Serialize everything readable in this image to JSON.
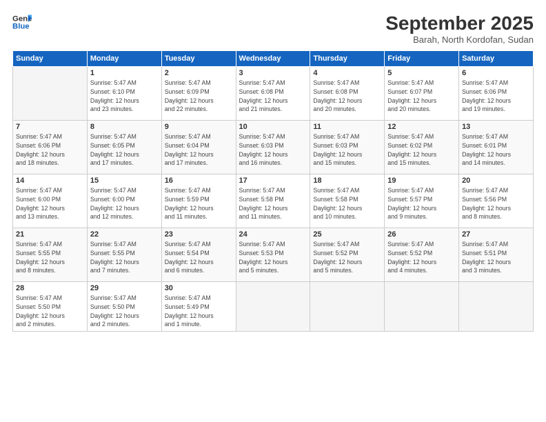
{
  "header": {
    "logo_line1": "General",
    "logo_line2": "Blue",
    "month_title": "September 2025",
    "subtitle": "Barah, North Kordofan, Sudan"
  },
  "days_of_week": [
    "Sunday",
    "Monday",
    "Tuesday",
    "Wednesday",
    "Thursday",
    "Friday",
    "Saturday"
  ],
  "weeks": [
    [
      {
        "day": "",
        "info": ""
      },
      {
        "day": "1",
        "info": "Sunrise: 5:47 AM\nSunset: 6:10 PM\nDaylight: 12 hours\nand 23 minutes."
      },
      {
        "day": "2",
        "info": "Sunrise: 5:47 AM\nSunset: 6:09 PM\nDaylight: 12 hours\nand 22 minutes."
      },
      {
        "day": "3",
        "info": "Sunrise: 5:47 AM\nSunset: 6:08 PM\nDaylight: 12 hours\nand 21 minutes."
      },
      {
        "day": "4",
        "info": "Sunrise: 5:47 AM\nSunset: 6:08 PM\nDaylight: 12 hours\nand 20 minutes."
      },
      {
        "day": "5",
        "info": "Sunrise: 5:47 AM\nSunset: 6:07 PM\nDaylight: 12 hours\nand 20 minutes."
      },
      {
        "day": "6",
        "info": "Sunrise: 5:47 AM\nSunset: 6:06 PM\nDaylight: 12 hours\nand 19 minutes."
      }
    ],
    [
      {
        "day": "7",
        "info": "Sunrise: 5:47 AM\nSunset: 6:06 PM\nDaylight: 12 hours\nand 18 minutes."
      },
      {
        "day": "8",
        "info": "Sunrise: 5:47 AM\nSunset: 6:05 PM\nDaylight: 12 hours\nand 17 minutes."
      },
      {
        "day": "9",
        "info": "Sunrise: 5:47 AM\nSunset: 6:04 PM\nDaylight: 12 hours\nand 17 minutes."
      },
      {
        "day": "10",
        "info": "Sunrise: 5:47 AM\nSunset: 6:03 PM\nDaylight: 12 hours\nand 16 minutes."
      },
      {
        "day": "11",
        "info": "Sunrise: 5:47 AM\nSunset: 6:03 PM\nDaylight: 12 hours\nand 15 minutes."
      },
      {
        "day": "12",
        "info": "Sunrise: 5:47 AM\nSunset: 6:02 PM\nDaylight: 12 hours\nand 15 minutes."
      },
      {
        "day": "13",
        "info": "Sunrise: 5:47 AM\nSunset: 6:01 PM\nDaylight: 12 hours\nand 14 minutes."
      }
    ],
    [
      {
        "day": "14",
        "info": "Sunrise: 5:47 AM\nSunset: 6:00 PM\nDaylight: 12 hours\nand 13 minutes."
      },
      {
        "day": "15",
        "info": "Sunrise: 5:47 AM\nSunset: 6:00 PM\nDaylight: 12 hours\nand 12 minutes."
      },
      {
        "day": "16",
        "info": "Sunrise: 5:47 AM\nSunset: 5:59 PM\nDaylight: 12 hours\nand 11 minutes."
      },
      {
        "day": "17",
        "info": "Sunrise: 5:47 AM\nSunset: 5:58 PM\nDaylight: 12 hours\nand 11 minutes."
      },
      {
        "day": "18",
        "info": "Sunrise: 5:47 AM\nSunset: 5:58 PM\nDaylight: 12 hours\nand 10 minutes."
      },
      {
        "day": "19",
        "info": "Sunrise: 5:47 AM\nSunset: 5:57 PM\nDaylight: 12 hours\nand 9 minutes."
      },
      {
        "day": "20",
        "info": "Sunrise: 5:47 AM\nSunset: 5:56 PM\nDaylight: 12 hours\nand 8 minutes."
      }
    ],
    [
      {
        "day": "21",
        "info": "Sunrise: 5:47 AM\nSunset: 5:55 PM\nDaylight: 12 hours\nand 8 minutes."
      },
      {
        "day": "22",
        "info": "Sunrise: 5:47 AM\nSunset: 5:55 PM\nDaylight: 12 hours\nand 7 minutes."
      },
      {
        "day": "23",
        "info": "Sunrise: 5:47 AM\nSunset: 5:54 PM\nDaylight: 12 hours\nand 6 minutes."
      },
      {
        "day": "24",
        "info": "Sunrise: 5:47 AM\nSunset: 5:53 PM\nDaylight: 12 hours\nand 5 minutes."
      },
      {
        "day": "25",
        "info": "Sunrise: 5:47 AM\nSunset: 5:52 PM\nDaylight: 12 hours\nand 5 minutes."
      },
      {
        "day": "26",
        "info": "Sunrise: 5:47 AM\nSunset: 5:52 PM\nDaylight: 12 hours\nand 4 minutes."
      },
      {
        "day": "27",
        "info": "Sunrise: 5:47 AM\nSunset: 5:51 PM\nDaylight: 12 hours\nand 3 minutes."
      }
    ],
    [
      {
        "day": "28",
        "info": "Sunrise: 5:47 AM\nSunset: 5:50 PM\nDaylight: 12 hours\nand 2 minutes."
      },
      {
        "day": "29",
        "info": "Sunrise: 5:47 AM\nSunset: 5:50 PM\nDaylight: 12 hours\nand 2 minutes."
      },
      {
        "day": "30",
        "info": "Sunrise: 5:47 AM\nSunset: 5:49 PM\nDaylight: 12 hours\nand 1 minute."
      },
      {
        "day": "",
        "info": ""
      },
      {
        "day": "",
        "info": ""
      },
      {
        "day": "",
        "info": ""
      },
      {
        "day": "",
        "info": ""
      }
    ]
  ]
}
